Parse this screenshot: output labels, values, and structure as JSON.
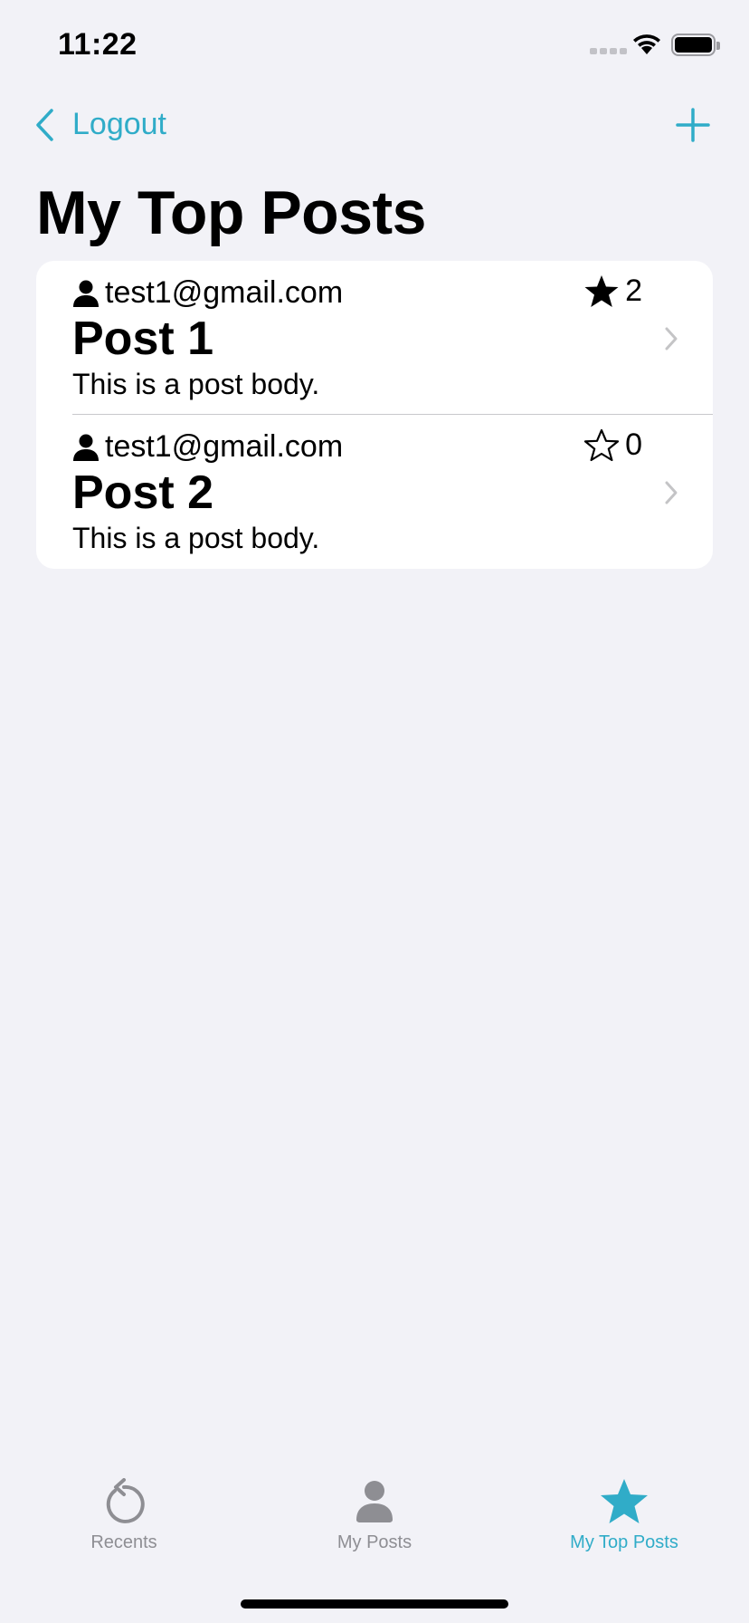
{
  "status_bar": {
    "time": "11:22"
  },
  "nav": {
    "back_label": "Logout",
    "add_icon": "plus-icon"
  },
  "page_title": "My Top Posts",
  "posts": [
    {
      "author": "test1@gmail.com",
      "title": "Post 1",
      "body": "This is a post body.",
      "stars": "2",
      "starred": true
    },
    {
      "author": "test1@gmail.com",
      "title": "Post 2",
      "body": "This is a post body.",
      "stars": "0",
      "starred": false
    }
  ],
  "tabs": [
    {
      "label": "Recents",
      "icon": "recents-icon",
      "active": false
    },
    {
      "label": "My Posts",
      "icon": "person-icon",
      "active": false
    },
    {
      "label": "My Top Posts",
      "icon": "star-icon",
      "active": true
    }
  ],
  "colors": {
    "accent": "#30acc8",
    "inactive": "#8e8e93",
    "background": "#f2f2f7"
  }
}
